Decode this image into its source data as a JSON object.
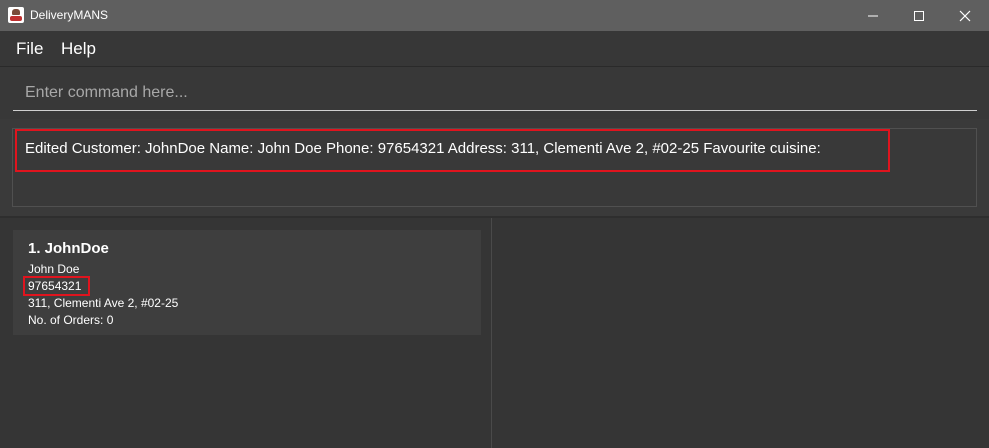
{
  "window": {
    "title": "DeliveryMANS"
  },
  "menu": {
    "file": "File",
    "help": "Help"
  },
  "command": {
    "placeholder": "Enter command here...",
    "value": ""
  },
  "result": {
    "text": "Edited Customer: JohnDoe Name: John Doe Phone: 97654321 Address: 311, Clementi Ave 2, #02-25 Favourite cuisine:"
  },
  "customers": [
    {
      "index": "1.",
      "title": "1.  JohnDoe",
      "name": "John Doe",
      "phone": "97654321",
      "address": "311, Clementi Ave 2, #02-25",
      "orders": "No. of Orders: 0"
    }
  ],
  "colors": {
    "highlight": "#e0141e",
    "titlebar": "#5f5f5f",
    "background": "#3a3a3a"
  },
  "icons": {
    "app": "delivery-app-icon",
    "minimize": "minimize-icon",
    "maximize": "maximize-icon",
    "close": "close-icon"
  }
}
